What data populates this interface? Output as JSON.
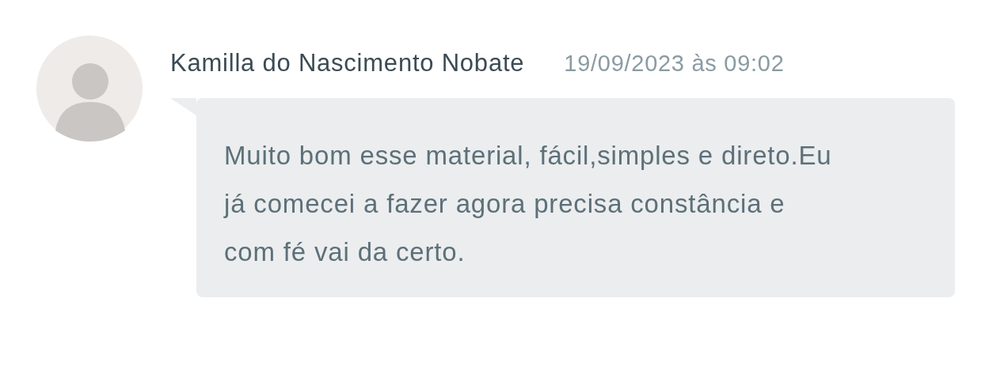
{
  "comment": {
    "author": "Kamilla do Nascimento Nobate",
    "date": "19/09/2023 às 09:02",
    "text": "Muito bom esse material, fácil,simples e direto.Eu já comecei a fazer agora precisa constância e com fé vai da certo."
  }
}
